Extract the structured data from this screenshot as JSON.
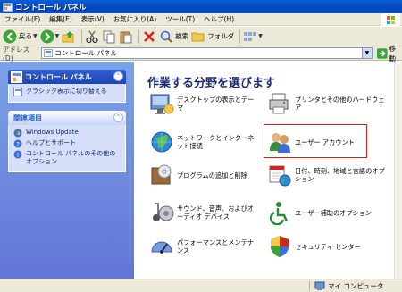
{
  "window": {
    "title": "コントロール パネル"
  },
  "menu": [
    "ファイル(F)",
    "編集(E)",
    "表示(V)",
    "お気に入り(A)",
    "ツール(T)",
    "ヘルプ(H)"
  ],
  "toolbar": {
    "back": "戻る",
    "search": "検索",
    "folders": "フォルダ"
  },
  "address": {
    "label": "アドレス(D)",
    "value": "コントロール パネル",
    "go": "移動"
  },
  "sidebar": {
    "control_panel": {
      "title": "コントロール パネル",
      "link": "クラシック表示に切り替える"
    },
    "related": {
      "title": "関連項目",
      "links": [
        "Windows Update",
        "ヘルプとサポート",
        "コントロール パネルのその他のオプション"
      ]
    }
  },
  "main": {
    "heading": "作業する分野を選びます",
    "categories": [
      "デスクトップの表示とテーマ",
      "プリンタとその他のハードウェア",
      "ネットワークとインターネット接続",
      "ユーザー アカウント",
      "プログラムの追加と削除",
      "日付、時刻、地域と言語のオプション",
      "サウンド、音声、およびオーディオ デバイス",
      "ユーザー補助のオプション",
      "パフォーマンスとメンテナンス",
      "セキュリティ センター"
    ]
  },
  "status": {
    "computer": "マイ コンピュータ"
  },
  "colors": {
    "highlight": "#d62020",
    "title_bar": "#0647b5",
    "sidebar": "#6f8ce0"
  }
}
